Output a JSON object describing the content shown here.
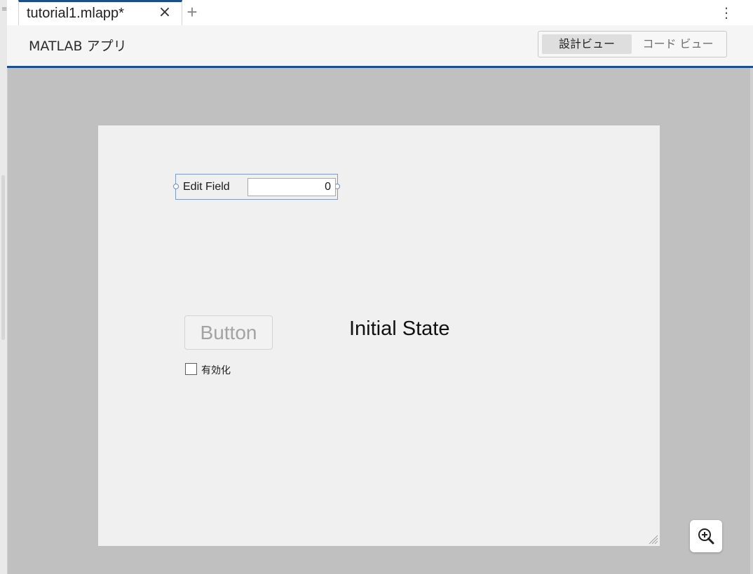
{
  "tab": {
    "title": "tutorial1.mlapp*",
    "close_glyph": "×",
    "add_glyph": "+",
    "menu_glyph": "⋮"
  },
  "header": {
    "title": "MATLAB アプリ",
    "views": [
      {
        "label": "設計ビュー",
        "selected": true
      },
      {
        "label": "コード ビュー",
        "selected": false
      }
    ]
  },
  "canvas": {
    "edit_field": {
      "label": "Edit Field",
      "value": "0"
    },
    "button": {
      "label": "Button",
      "enabled": false
    },
    "checkbox": {
      "label": "有効化",
      "checked": false
    },
    "state_label": "Initial State"
  },
  "icons": {
    "zoom": "zoom-in-icon",
    "resize": "resize-grip-icon"
  },
  "colors": {
    "accent": "#1b4e8e",
    "selection": "#7d9ad1",
    "workspace": "#c0c0c0",
    "canvas": "#f0f0f0"
  }
}
